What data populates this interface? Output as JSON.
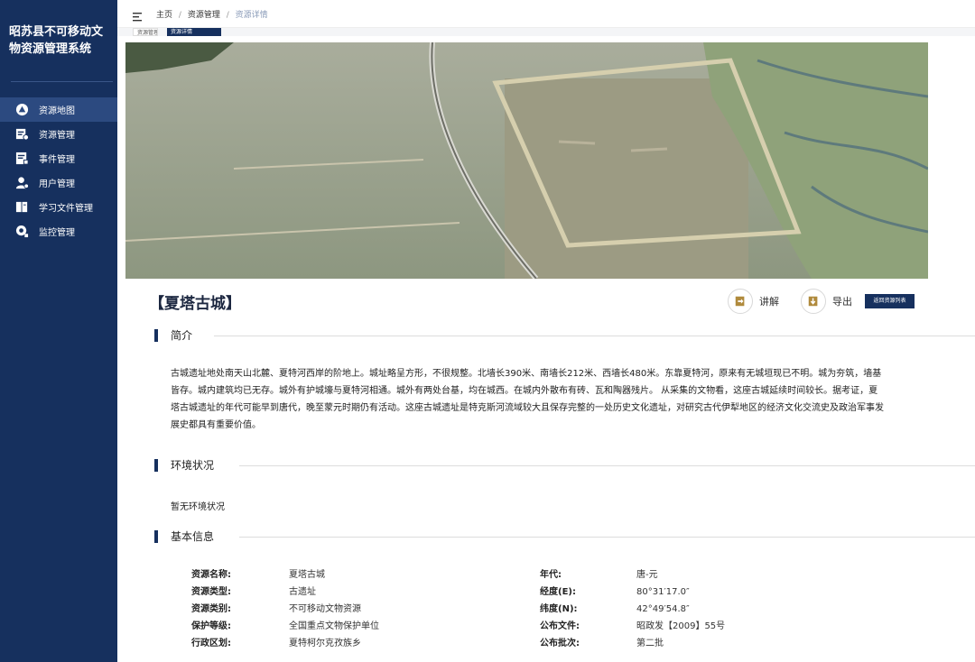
{
  "app": {
    "title": "昭苏县不可移动文物资源管理系统"
  },
  "sidebar": {
    "items": [
      {
        "label": "资源地图",
        "icon": "map-pin-icon",
        "active": true
      },
      {
        "label": "资源管理",
        "icon": "resource-icon",
        "active": false
      },
      {
        "label": "事件管理",
        "icon": "event-icon",
        "active": false
      },
      {
        "label": "用户管理",
        "icon": "user-icon",
        "active": false
      },
      {
        "label": "学习文件管理",
        "icon": "file-icon",
        "active": false
      },
      {
        "label": "监控管理",
        "icon": "monitor-icon",
        "active": false
      }
    ]
  },
  "header": {
    "breadcrumb": [
      "主页",
      "资源管理",
      "资源详情"
    ],
    "tabs": [
      "资源管理",
      "资源详情"
    ]
  },
  "site": {
    "title": "【夏塔古城】",
    "actions": {
      "explain": "讲解",
      "export": "导出",
      "back": "返回资源列表"
    }
  },
  "sections": {
    "intro": {
      "heading": "简介",
      "text": "古城遗址地处南天山北麓、夏特河西岸的阶地上。城址略呈方形，不很规整。北墙长390米、南墙长212米、西墙长480米。东靠夏特河，原来有无城垣现已不明。城为夯筑，墙基皆存。城内建筑均已无存。城外有护城壕与夏特河相通。城外有两处台基，均在城西。在城内外散布有砖、瓦和陶器残片。 从采集的文物看，这座古城延续时间较长。据考证，夏塔古城遗址的年代可能早到唐代，晚至蒙元时期仍有活动。这座古城遗址是特克斯河流域较大且保存完整的一处历史文化遗址，对研究古代伊犁地区的经济文化交流史及政治军事发展史都具有重要价值。"
    },
    "environment": {
      "heading": "环境状况",
      "text": "暂无环境状况"
    },
    "basic": {
      "heading": "基本信息",
      "left": [
        {
          "label": "资源名称:",
          "value": "夏塔古城"
        },
        {
          "label": "资源类型:",
          "value": "古遗址"
        },
        {
          "label": "资源类别:",
          "value": "不可移动文物资源"
        },
        {
          "label": "保护等级:",
          "value": "全国重点文物保护单位"
        },
        {
          "label": "行政区划:",
          "value": "夏特柯尔克孜族乡"
        }
      ],
      "right": [
        {
          "label": "年代:",
          "value": "唐-元"
        },
        {
          "label": "经度(E):",
          "value": "80°31′17.0″"
        },
        {
          "label": "纬度(N):",
          "value": "42°49′54.8″"
        },
        {
          "label": "公布文件:",
          "value": "昭政发【2009】55号"
        },
        {
          "label": "公布批次:",
          "value": "第二批"
        }
      ]
    }
  },
  "colors": {
    "sidebar": "#16305e",
    "sidebar_active": "#2c4a80",
    "accent_icon": "#b08a3c"
  }
}
